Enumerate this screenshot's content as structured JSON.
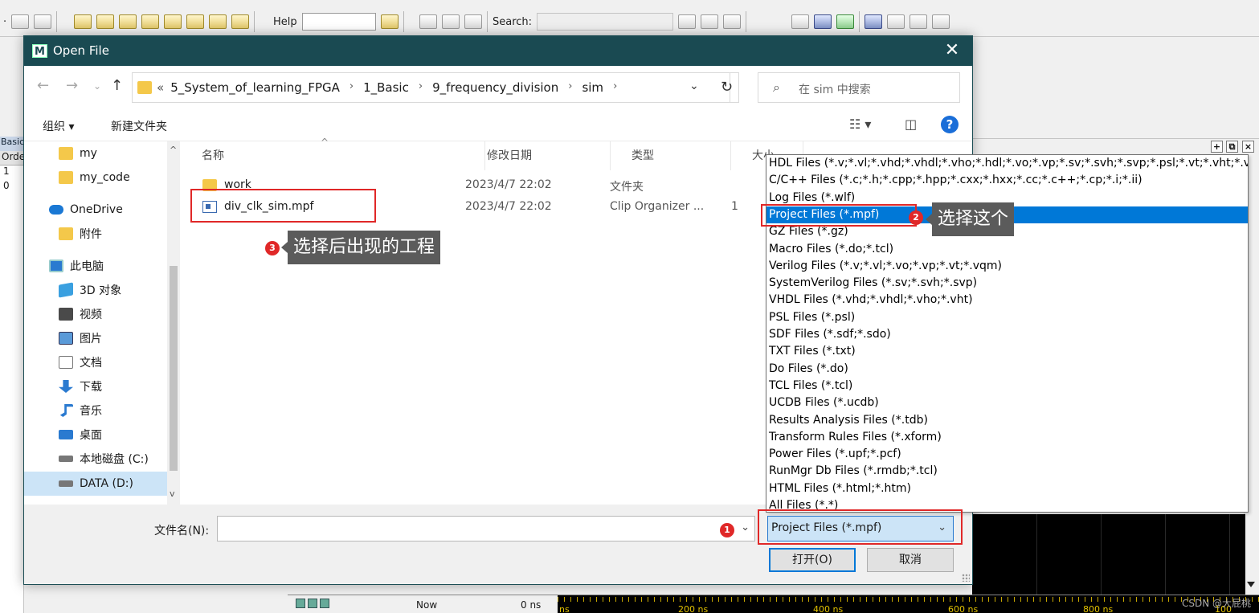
{
  "app_toolbar": {
    "help_label": "Help",
    "search_label": "Search:"
  },
  "left_strip": {
    "tab": "Basic/",
    "col": "Orde",
    "rows": [
      "1",
      "0"
    ]
  },
  "bottom_bar": {
    "now_label": "Now",
    "now_value": "0 ns",
    "ticks": [
      "ns",
      "200 ns",
      "400 ns",
      "600 ns",
      "800 ns",
      "100"
    ]
  },
  "watermark": "CSDN @大屁桃",
  "dialog": {
    "title": "Open File",
    "app_icon": "M",
    "close": "✕",
    "breadcrumb": [
      "5_System_of_learning_FPGA",
      "1_Basic",
      "9_frequency_division",
      "sim"
    ],
    "breadcrumb_prefix": "«",
    "search_placeholder": "在 sim 中搜索",
    "toolbar": {
      "organize": "组织 ▾",
      "new_folder": "新建文件夹",
      "view": "☷ ▾",
      "pane": "◫",
      "help": "?"
    },
    "sidebar": [
      {
        "label": "my",
        "icon": "folder",
        "indent": true
      },
      {
        "label": "my_code",
        "icon": "folder",
        "indent": true
      },
      {
        "label": "OneDrive",
        "icon": "cloud",
        "indent": false
      },
      {
        "label": "附件",
        "icon": "folder",
        "indent": true
      },
      {
        "label": "此电脑",
        "icon": "pc",
        "indent": false
      },
      {
        "label": "3D 对象",
        "icon": "obj3d",
        "indent": true
      },
      {
        "label": "视频",
        "icon": "video",
        "indent": true
      },
      {
        "label": "图片",
        "icon": "pic",
        "indent": true
      },
      {
        "label": "文档",
        "icon": "doc",
        "indent": true
      },
      {
        "label": "下载",
        "icon": "down",
        "indent": true
      },
      {
        "label": "音乐",
        "icon": "music",
        "indent": true
      },
      {
        "label": "桌面",
        "icon": "desk",
        "indent": true
      },
      {
        "label": "本地磁盘 (C:)",
        "icon": "drive",
        "indent": true
      },
      {
        "label": "DATA (D:)",
        "icon": "drive",
        "indent": true,
        "selected": true
      }
    ],
    "columns": {
      "name": "名称",
      "date": "修改日期",
      "type": "类型",
      "size": "大小"
    },
    "files": [
      {
        "name": "work",
        "date": "2023/4/7 22:02",
        "type": "文件夹",
        "size": "",
        "icon": "folder"
      },
      {
        "name": "div_clk_sim.mpf",
        "date": "2023/4/7 22:02",
        "type": "Clip Organizer ...",
        "size": "1",
        "icon": "mpf"
      }
    ],
    "filename_label": "文件名(N):",
    "filename_value": "",
    "file_type_selected": "Project Files (*.mpf)",
    "open_button": "打开(O)",
    "cancel_button": "取消",
    "file_types": [
      "HDL Files (*.v;*.vl;*.vhd;*.vhdl;*.vho;*.hdl;*.vo;*.vp;*.sv;*.svh;*.svp;*.psl;*.vt;*.vht;*.vqm)",
      "C/C++ Files (*.c;*.h;*.cpp;*.hpp;*.cxx;*.hxx;*.cc;*.c++;*.cp;*.i;*.ii)",
      "Log Files (*.wlf)",
      "Project Files (*.mpf)",
      "GZ Files (*.gz)",
      "Macro Files (*.do;*.tcl)",
      "Verilog Files (*.v;*.vl;*.vo;*.vp;*.vt;*.vqm)",
      "SystemVerilog Files (*.sv;*.svh;*.svp)",
      "VHDL Files (*.vhd;*.vhdl;*.vho;*.vht)",
      "PSL Files (*.psl)",
      "SDF Files (*.sdf;*.sdo)",
      "TXT Files (*.txt)",
      "Do Files (*.do)",
      "TCL Files (*.tcl)",
      "UCDB Files (*.ucdb)",
      "Results Analysis Files (*.tdb)",
      "Transform Rules Files (*.xform)",
      "Power Files (*.upf;*.pcf)",
      "RunMgr Db Files (*.rmdb;*.tcl)",
      "HTML Files (*.html;*.htm)",
      "All Files (*.*)"
    ],
    "file_types_selected_index": 3
  },
  "annotations": {
    "step1": "1",
    "step2": "2",
    "step2_text": "选择这个",
    "step3": "3",
    "step3_text": "选择后出现的工程"
  },
  "colors": {
    "titlebar": "#1a4a52",
    "highlight": "#0078d7",
    "annotation_red": "#e02828",
    "callout_bg": "#5b5b5b"
  }
}
